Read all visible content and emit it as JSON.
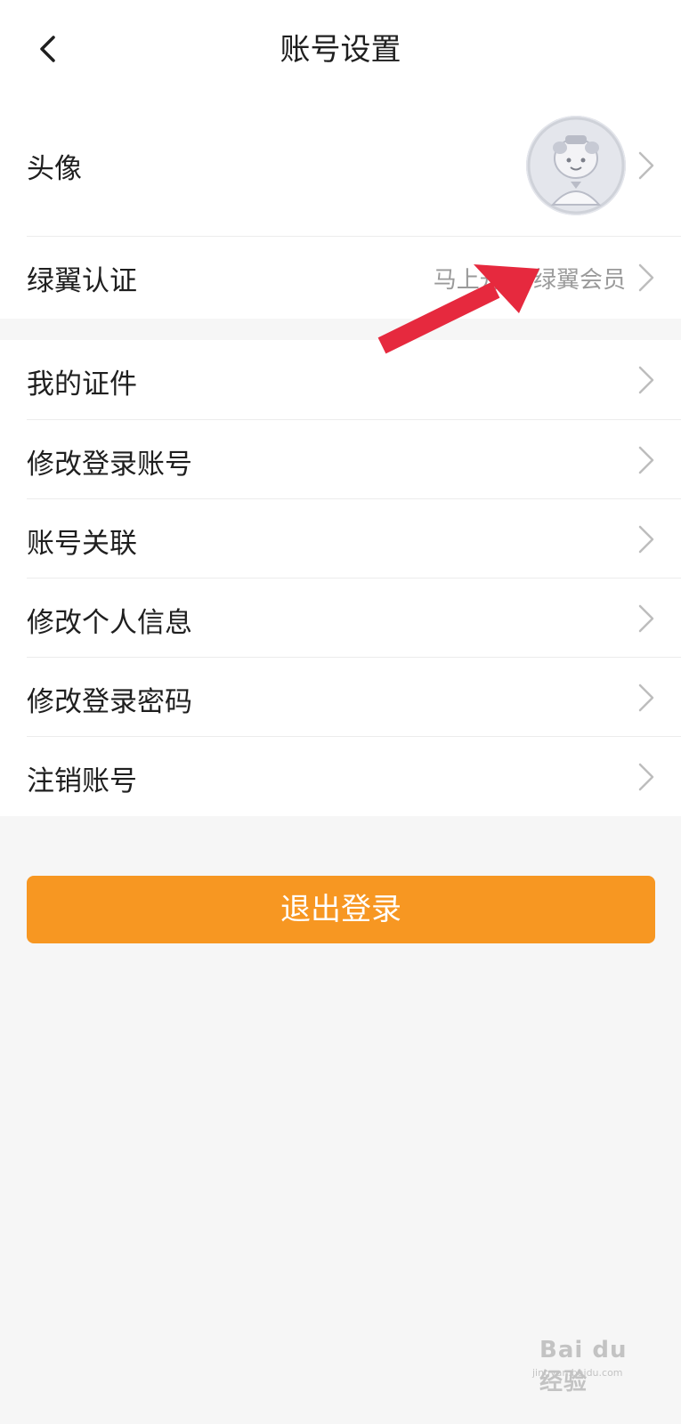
{
  "header": {
    "title": "账号设置",
    "back_icon": "chevron-left-icon"
  },
  "group1": [
    {
      "id": "avatar",
      "label": "头像",
      "value": ""
    },
    {
      "id": "green-wing",
      "label": "绿翼认证",
      "value": "马上升级 绿翼会员"
    }
  ],
  "group2": [
    {
      "id": "my-documents",
      "label": "我的证件"
    },
    {
      "id": "change-login-account",
      "label": "修改登录账号"
    },
    {
      "id": "account-link",
      "label": "账号关联"
    },
    {
      "id": "edit-personal-info",
      "label": "修改个人信息"
    },
    {
      "id": "change-login-password",
      "label": "修改登录密码"
    },
    {
      "id": "delete-account",
      "label": "注销账号"
    }
  ],
  "logout": {
    "label": "退出登录",
    "color": "#f79722"
  },
  "colors": {
    "annotation_arrow": "#e6293e",
    "background": "#f6f6f6"
  },
  "watermark": {
    "text": "Bai du 经验",
    "sub": "jingyan.baidu.com"
  }
}
